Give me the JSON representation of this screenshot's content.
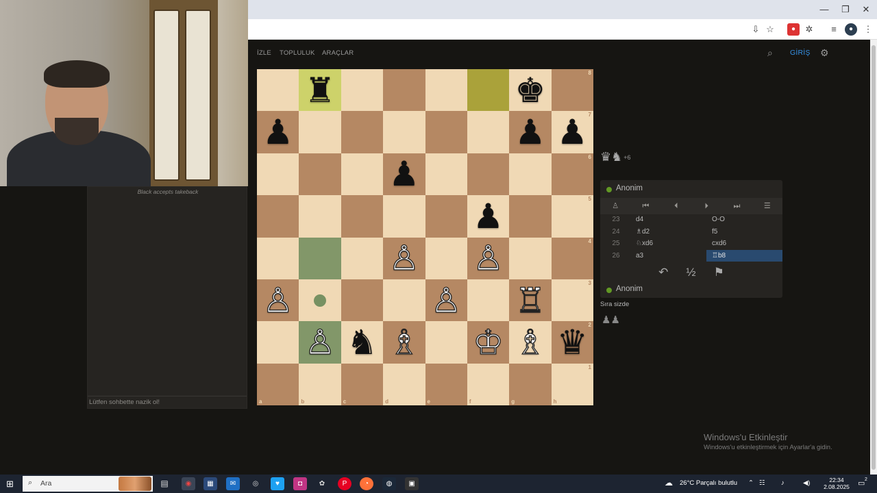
{
  "browser": {
    "minimize": "—",
    "maximize": "❐",
    "close": "✕"
  },
  "chat": {
    "message": "Black accepts takeback",
    "placeholder": "Lütfen sohbette nazik ol!"
  },
  "nav": {
    "items": [
      "İZLE",
      "TOPLULUK",
      "ARAÇLAR"
    ],
    "login": "GİRİŞ"
  },
  "board": {
    "files": [
      "a",
      "b",
      "c",
      "d",
      "e",
      "f",
      "g",
      "h"
    ],
    "ranks": [
      "8",
      "7",
      "6",
      "5",
      "4",
      "3",
      "2",
      "1"
    ],
    "pieces": [
      {
        "square": "b8",
        "glyph": "♜",
        "color": "black"
      },
      {
        "square": "g8",
        "glyph": "♚",
        "color": "black"
      },
      {
        "square": "a7",
        "glyph": "♟",
        "color": "black"
      },
      {
        "square": "g7",
        "glyph": "♟",
        "color": "black"
      },
      {
        "square": "h7",
        "glyph": "♟",
        "color": "black"
      },
      {
        "square": "d6",
        "glyph": "♟",
        "color": "black"
      },
      {
        "square": "f5",
        "glyph": "♟",
        "color": "black"
      },
      {
        "square": "d4",
        "glyph": "♙",
        "color": "white"
      },
      {
        "square": "f4",
        "glyph": "♙",
        "color": "white"
      },
      {
        "square": "a3",
        "glyph": "♙",
        "color": "white"
      },
      {
        "square": "e3",
        "glyph": "♙",
        "color": "white"
      },
      {
        "square": "g3",
        "glyph": "♖",
        "color": "white"
      },
      {
        "square": "b2",
        "glyph": "♙",
        "color": "white"
      },
      {
        "square": "c2",
        "glyph": "♞",
        "color": "black"
      },
      {
        "square": "d2",
        "glyph": "♗",
        "color": "white"
      },
      {
        "square": "f2",
        "glyph": "♔",
        "color": "white"
      },
      {
        "square": "g2",
        "glyph": "♗",
        "color": "white"
      },
      {
        "square": "h2",
        "glyph": "♛",
        "color": "black"
      }
    ],
    "last_move_light": [
      "b8"
    ],
    "last_move_dark": [
      "f8"
    ],
    "selected": [
      "b4",
      "b2"
    ],
    "move_dots": [
      "b3"
    ]
  },
  "material": {
    "pieces": "♛♞",
    "diff": "+6"
  },
  "game": {
    "top_player": "Anonim",
    "bottom_player": "Anonim",
    "controls": [
      "♙",
      "⏮",
      "⏴",
      "⏵",
      "⏭",
      "☰"
    ],
    "moves": [
      {
        "n": "23",
        "w": "d4",
        "b": "O-O"
      },
      {
        "n": "24",
        "w": "♗d2",
        "b": "f5"
      },
      {
        "n": "25",
        "w": "♘xd6",
        "b": "cxd6"
      },
      {
        "n": "26",
        "w": "a3",
        "b": "♖b8"
      }
    ],
    "active_move": "26b",
    "takeback": "↶",
    "draw": "½",
    "resign": "⚑"
  },
  "turn_text": "Sıra sizde",
  "captured": "♟♟",
  "watermark": {
    "title": "Windows'u Etkinleştir",
    "subtitle": "Windows'u etkinleştirmek için Ayarlar'a gidin."
  },
  "taskbar": {
    "search_placeholder": "Ara",
    "weather": "26°C  Parçalı bulutlu",
    "time": "22:34",
    "date": "2.08.2025",
    "notification_count": "2"
  }
}
